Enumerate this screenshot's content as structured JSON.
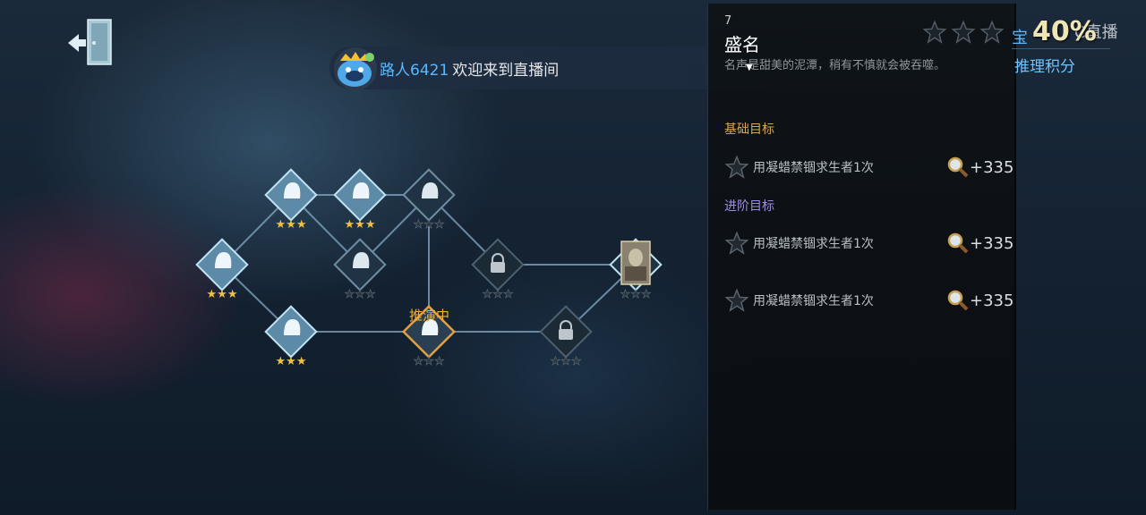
{
  "welcome": {
    "username": "路人6421",
    "message": "欢迎来到直播间"
  },
  "map": {
    "deducing_label": "推演中"
  },
  "panel": {
    "number": "7",
    "title": "盛名",
    "description": "名声是甜美的泥潭，稍有不慎就会被吞噬。",
    "basic_label": "基础目标",
    "advanced_label": "进阶目标",
    "goals": [
      {
        "text": "用凝蜡禁锢求生者1次",
        "points": "+335"
      },
      {
        "text": "用凝蜡禁锢求生者1次",
        "points": "+335"
      },
      {
        "text": "用凝蜡禁锢求生者1次",
        "points": "+335"
      }
    ]
  },
  "top": {
    "stars_filled": 0,
    "stars_total": 3,
    "percent": "40%",
    "reasoning_points_label": "推理积分",
    "live_label": "C直播",
    "partial_char": "宝"
  },
  "colors": {
    "gold": "#f0b030",
    "blue": "#5bb8ff",
    "purple": "#9b8fe0"
  }
}
